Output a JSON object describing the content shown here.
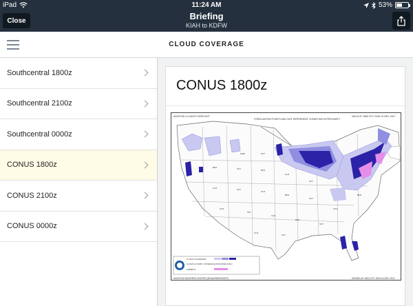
{
  "status_bar": {
    "carrier": "iPad",
    "time": "11:24 AM",
    "battery": "53%",
    "battery_level": 0.53
  },
  "nav": {
    "close_label": "Close",
    "title": "Briefing",
    "subtitle": "KIAH to KDFW"
  },
  "section": {
    "title": "CLOUD COVERAGE"
  },
  "sidebar": {
    "items": [
      {
        "label": "Southcentral 1800z",
        "selected": false
      },
      {
        "label": "Southcentral 2100z",
        "selected": false
      },
      {
        "label": "Southcentral 0000z",
        "selected": false
      },
      {
        "label": "CONUS 1800z",
        "selected": true
      },
      {
        "label": "CONUS 2100z",
        "selected": false
      },
      {
        "label": "CONUS 0000z",
        "selected": false
      }
    ]
  },
  "detail": {
    "title": "CONUS 1800z",
    "map": {
      "header_left": "AVIATION CLOUDS FORECAST",
      "header_center": "FORECASTED POINTS MAY NOT REPRESENT CONDITION IN PROXIMITY",
      "header_right": "VALID AT 1800 UTC SUN 10 DEC 2017",
      "footer_left": "AVIATION WEATHER CENTER (NOAA/NWS/NCEP)",
      "footer_right": "ISSUED AT 1602 UTC SUN 10 DEC 2017",
      "legend_row1": "CLOUD COVERAGE",
      "legend_row2": "CLOUD LAYERS: COVERAGE AND BASE (MSL)",
      "legend_row3": "AIRMETS",
      "colors": {
        "light": "#c9c8f0",
        "medium": "#8f8ee0",
        "dark": "#2b22a8",
        "accent": "#e48ee8"
      }
    }
  }
}
